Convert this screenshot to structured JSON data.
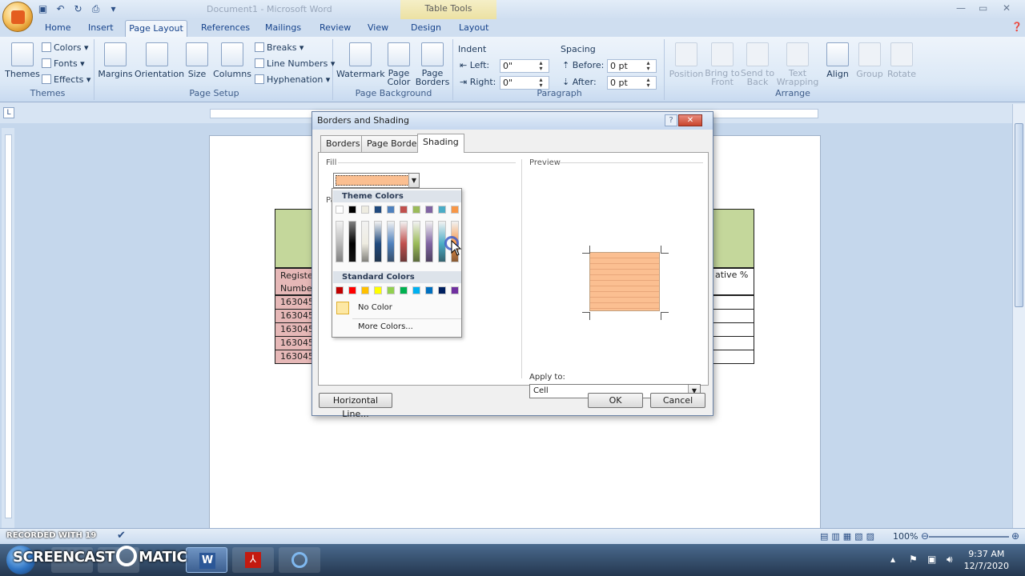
{
  "app": {
    "window_title": "Document1 - Microsoft Word",
    "context_tab_group": "Table Tools"
  },
  "tabs": [
    "Home",
    "Insert",
    "Page Layout",
    "References",
    "Mailings",
    "Review",
    "View",
    "Design",
    "Layout"
  ],
  "ribbon": {
    "themes": {
      "themes_label": "Themes",
      "colors": "Colors",
      "fonts": "Fonts",
      "effects": "Effects",
      "group": "Themes"
    },
    "page_setup": {
      "margins": "Margins",
      "orientation": "Orientation",
      "size": "Size",
      "columns": "Columns",
      "breaks": "Breaks",
      "line_numbers": "Line Numbers",
      "hyphenation": "Hyphenation",
      "group": "Page Setup"
    },
    "page_background": {
      "watermark": "Watermark",
      "page_color_1": "Page",
      "page_color_2": "Color",
      "page_borders_1": "Page",
      "page_borders_2": "Borders",
      "group": "Page Background"
    },
    "paragraph": {
      "indent": "Indent",
      "left_label": "Left:",
      "left_value": "0\"",
      "right_label": "Right:",
      "right_value": "0\"",
      "spacing": "Spacing",
      "before_label": "Before:",
      "before_value": "0 pt",
      "after_label": "After:",
      "after_value": "0 pt",
      "group": "Paragraph"
    },
    "arrange": {
      "position": "Position",
      "bring_1": "Bring to",
      "bring_2": "Front",
      "send_1": "Send to",
      "send_2": "Back",
      "text_1": "Text",
      "text_2": "Wrapping",
      "align": "Align",
      "group_btn": "Group",
      "rotate": "Rotate",
      "group": "Arrange"
    }
  },
  "document": {
    "row_labels": [
      "Registe",
      "Numbe",
      "163045",
      "163045",
      "163045",
      "163045",
      "163045"
    ],
    "right_header": "ative %"
  },
  "dialog": {
    "title": "Borders and Shading",
    "help": "?",
    "close": "✕",
    "tabs": [
      "Borders",
      "Page Border",
      "Shading"
    ],
    "active_tab": "Shading",
    "fill_label": "Fill",
    "pattern_label_partial": "Pa",
    "preview_label": "Preview",
    "apply_to_label": "Apply to:",
    "apply_to_value": "Cell",
    "horizontal_line_btn": "Horizontal Line...",
    "ok": "OK",
    "cancel": "Cancel",
    "selected_fill_color": "#fbbf91"
  },
  "palette": {
    "theme_colors_label": "Theme Colors",
    "standard_colors_label": "Standard Colors",
    "no_color_label": "No Color",
    "more_colors_label": "More Colors...",
    "theme_top": [
      "#ffffff",
      "#000000",
      "#eeece1",
      "#1f497d",
      "#4f81bd",
      "#c0504d",
      "#9bbb59",
      "#8064a2",
      "#4bacc6",
      "#f79646"
    ],
    "standard": [
      "#c00000",
      "#ff0000",
      "#ffc000",
      "#ffff00",
      "#92d050",
      "#00b050",
      "#00b0f0",
      "#0070c0",
      "#002060",
      "#7030a0"
    ]
  },
  "status": {
    "recorded_with": "RECORDED WITH",
    "page_count": "19",
    "zoom": "100%",
    "screencast_logo": "SCREENCAST",
    "screencast_logo_2": "MATIC"
  },
  "clock": {
    "time": "9:37 AM",
    "date": "12/7/2020"
  }
}
